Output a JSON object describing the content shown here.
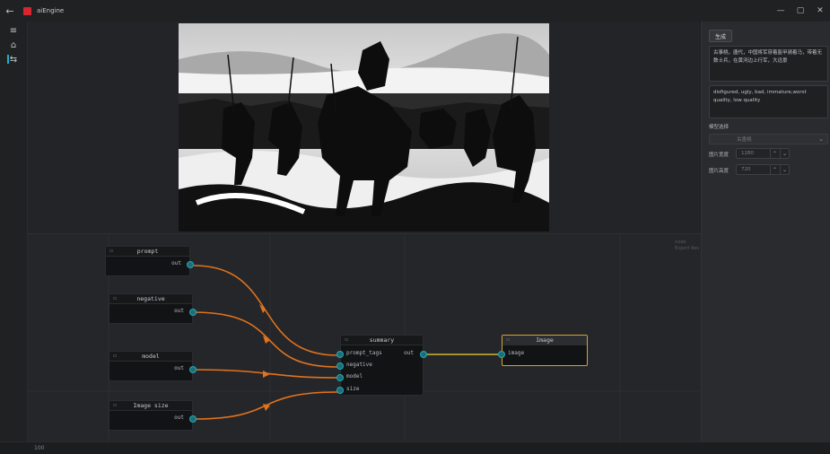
{
  "window": {
    "title": "aiEngine",
    "controls": [
      "minimize",
      "maximize",
      "close"
    ],
    "back_icon": "arrow-left-icon"
  },
  "rail": {
    "items": [
      {
        "icon": "menu-icon",
        "glyph": "≡"
      },
      {
        "icon": "home-icon",
        "glyph": "⌂"
      },
      {
        "icon": "flow-icon",
        "glyph": "⇆",
        "active": true
      }
    ]
  },
  "preview": {
    "alt": "generated image"
  },
  "canvas": {
    "corner_note": [
      "node",
      "Export Res"
    ],
    "nodes": {
      "prompt": {
        "title": "prompt",
        "out": "out"
      },
      "negative": {
        "title": "negative",
        "out": "out"
      },
      "model": {
        "title": "model",
        "out": "out"
      },
      "image_size": {
        "title": "Image size",
        "out": "out"
      },
      "summary": {
        "title": "summary",
        "inputs": [
          "prompt_tags",
          "negative",
          "model",
          "size"
        ],
        "out": "out"
      },
      "image": {
        "title": "Image",
        "inputs": [
          "image"
        ]
      }
    },
    "colors": {
      "wire_orange": "#e0731e",
      "wire_yellow": "#d4b52a",
      "port": "#26a7b5",
      "selected_border": "#d4a52a"
    }
  },
  "panel": {
    "generate_label": "生成",
    "prompt_text": "古事桃，唐代，中国将军穿着盔甲骑着马，带着无数士兵，在黄河边上行军，大远景",
    "negative_text": "disfigured, ugly, bad, immature,worst quality, low quality",
    "model_label": "模型选择",
    "model_value": "古墨桃",
    "width_label": "图片宽度",
    "width_value": "1280",
    "height_label": "图片高度",
    "height_value": "720",
    "step_up": "⌃",
    "step_down": "⌄"
  },
  "status": {
    "text": "100"
  }
}
